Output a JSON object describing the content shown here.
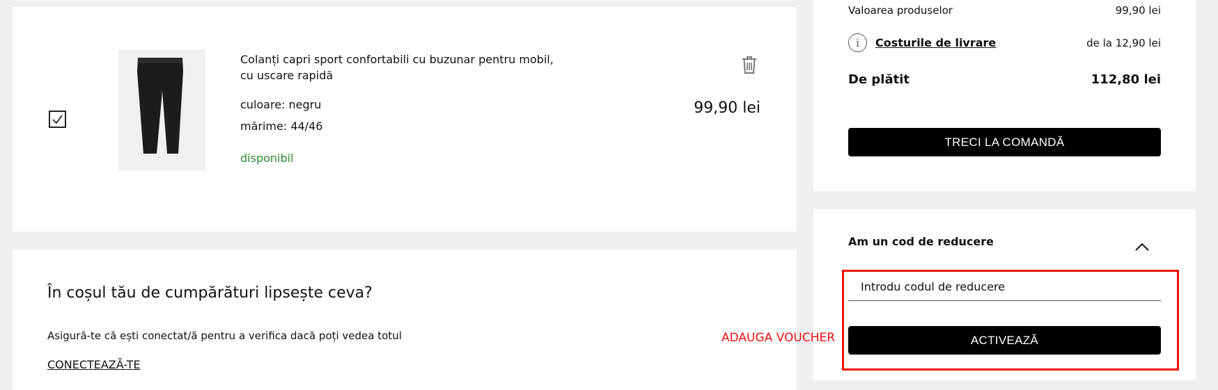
{
  "product": {
    "title": "Colanți capri sport confortabili cu buzunar pentru mobil, cu uscare rapidă",
    "color": "culoare: negru",
    "size": "mărime: 44/46",
    "availability": "disponibil",
    "price": "99,90 lei",
    "selected": true,
    "delete_icon": "trash-icon"
  },
  "missing": {
    "title": "În coșul tău de cumpărături lipsește ceva?",
    "text": "Asigură-te că ești conectat/ă pentru a verifica dacă poți vedea totul",
    "link": "CONECTEAZĂ-TE"
  },
  "summary": {
    "items_label": "Valoarea produselor",
    "items_value": "99,90 lei",
    "shipping_label": "Costurile de livrare",
    "shipping_value": "de la 12,90 lei",
    "total_label": "De plătit",
    "total_value": "112,80 lei",
    "order_button": "TRECI LA COMANDĂ"
  },
  "voucher": {
    "title": "Am un cod de reducere",
    "placeholder": "Introdu codul de reducere",
    "activate_button": "ACTIVEAZĂ"
  },
  "annotation": {
    "label": "ADAUGA VOUCHER",
    "color": "#ee1111"
  },
  "colors": {
    "available": "#2f8a2f",
    "button_bg": "#000000",
    "page_bg": "#efefef"
  }
}
